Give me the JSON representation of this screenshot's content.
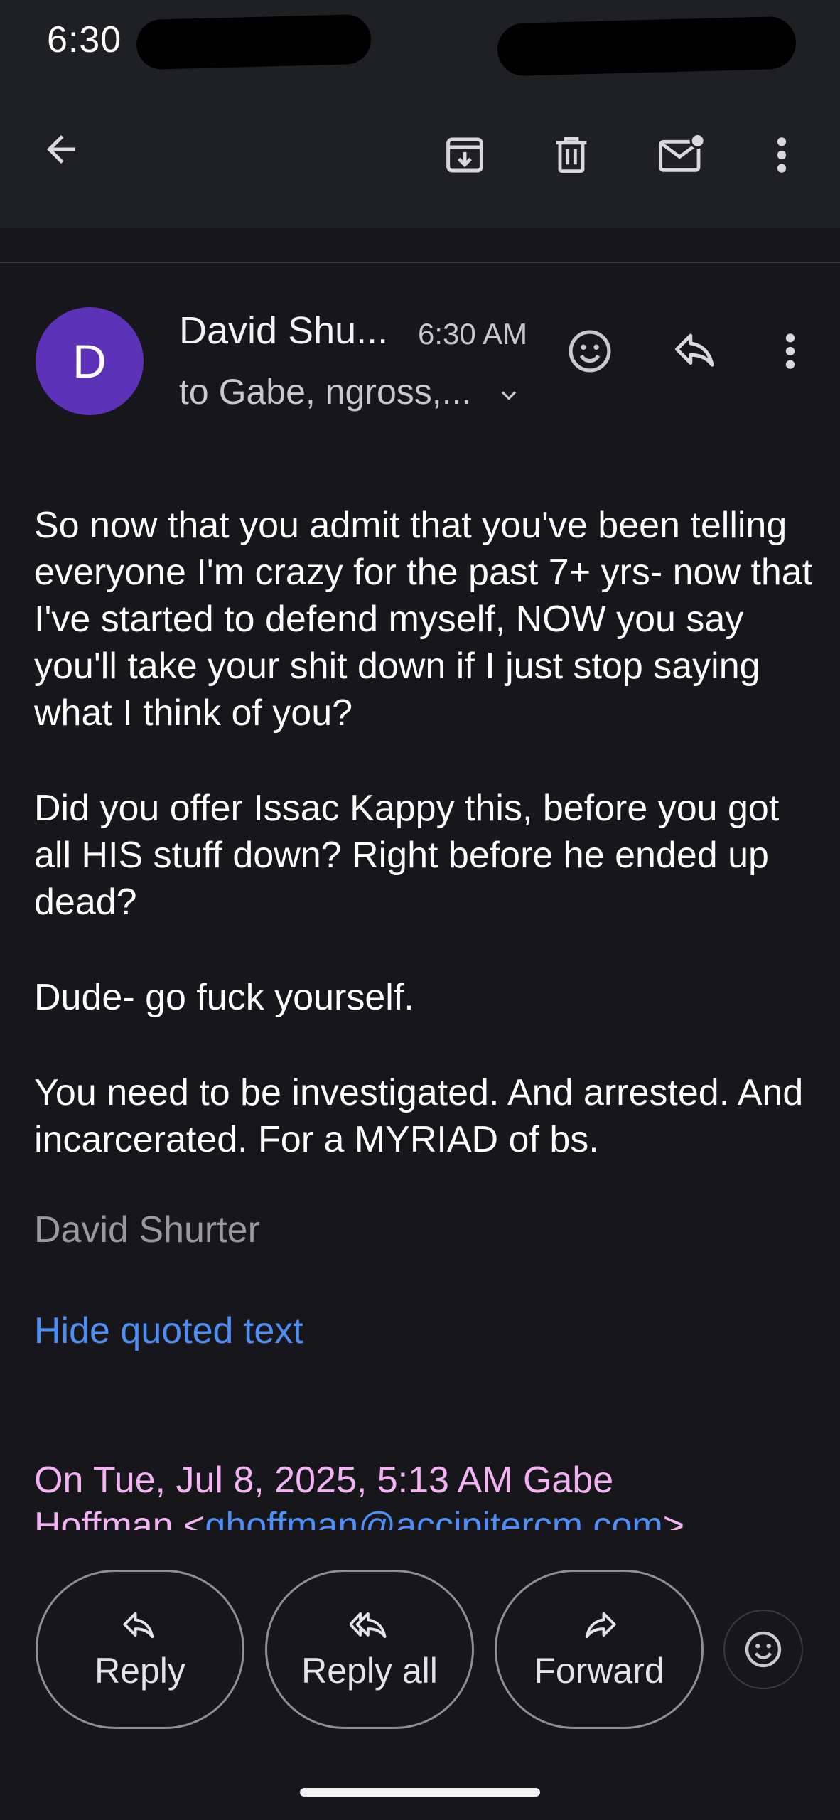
{
  "status_bar": {
    "time": "6:30"
  },
  "toolbar": {
    "back": "arrow-left-icon",
    "archive": "archive-icon",
    "delete": "trash-icon",
    "mark_unread": "mail-unread-icon",
    "more": "more-vert-icon"
  },
  "message": {
    "avatar_letter": "D",
    "sender": "David Shu...",
    "time": "6:30 AM",
    "recipients": "to Gabe, ngross,...",
    "paragraphs": [
      "So now that you admit that you've been telling everyone I'm crazy for the past 7+ yrs- now that I've started to defend myself, NOW you say you'll take your shit down if I just stop saying what I think of you?",
      "Did you offer Issac Kappy this, before you got all HIS stuff down? Right before he ended up dead?",
      "Dude- go fuck yourself.",
      "You need to be investigated. And arrested. And incarcerated. For a MYRIAD of bs."
    ],
    "signature": "David Shurter",
    "hide_quoted": "Hide quoted text",
    "quote_line1": "On Tue, Jul 8, 2025, 5:13 AM Gabe",
    "quote_line2_prefix": "Hoffman <",
    "quote_email": "ghoffman@accipitercm.com",
    "quote_line2_suffix": ">"
  },
  "actions": {
    "reply": "Reply",
    "reply_all": "Reply all",
    "forward": "Forward"
  },
  "colors": {
    "background": "#16161b",
    "bar": "#1f2024",
    "avatar": "#5b32b8",
    "link": "#4e8ef5",
    "quote": "#f3b3f2"
  }
}
